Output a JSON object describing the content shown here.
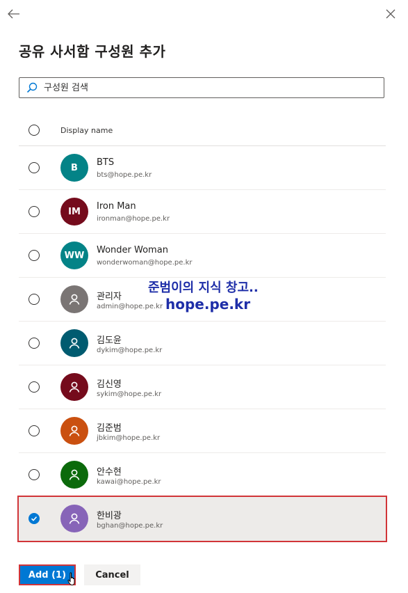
{
  "title": "공유 사서함 구성원 추가",
  "search": {
    "placeholder": "구성원 검색",
    "value": ""
  },
  "table": {
    "header": "Display name"
  },
  "members": [
    {
      "name": "BTS",
      "email": "bts@hope.pe.kr",
      "initials": "B",
      "color": "#038387",
      "avatar_type": "initials",
      "selected": false
    },
    {
      "name": "Iron Man",
      "email": "ironman@hope.pe.kr",
      "initials": "IM",
      "color": "#750b1c",
      "avatar_type": "initials",
      "selected": false
    },
    {
      "name": "Wonder Woman",
      "email": "wonderwoman@hope.pe.kr",
      "initials": "WW",
      "color": "#038387",
      "avatar_type": "initials",
      "selected": false
    },
    {
      "name": "관리자",
      "email": "admin@hope.pe.kr",
      "initials": "",
      "color": "#7a7574",
      "avatar_type": "person-icon",
      "selected": false
    },
    {
      "name": "김도윤",
      "email": "dykim@hope.pe.kr",
      "initials": "",
      "color": "#005b70",
      "avatar_type": "person-icon",
      "selected": false
    },
    {
      "name": "김신영",
      "email": "sykim@hope.pe.kr",
      "initials": "",
      "color": "#750b1c",
      "avatar_type": "person-icon",
      "selected": false
    },
    {
      "name": "김준범",
      "email": "jbkim@hope.pe.kr",
      "initials": "",
      "color": "#ca5010",
      "avatar_type": "person-icon",
      "selected": false
    },
    {
      "name": "안수현",
      "email": "kawai@hope.pe.kr",
      "initials": "",
      "color": "#0b6a0b",
      "avatar_type": "person-icon",
      "selected": false
    },
    {
      "name": "한비광",
      "email": "bghan@hope.pe.kr",
      "initials": "",
      "color": "#8764b8",
      "avatar_type": "person-icon",
      "selected": true
    }
  ],
  "watermark": {
    "line1": "준범이의 지식 창고..",
    "line2": "hope.pe.kr"
  },
  "buttons": {
    "add": "Add (1)",
    "cancel": "Cancel"
  },
  "colors": {
    "primary": "#0078d4",
    "highlight_border": "#d13438",
    "selected_bg": "#edebe9"
  }
}
